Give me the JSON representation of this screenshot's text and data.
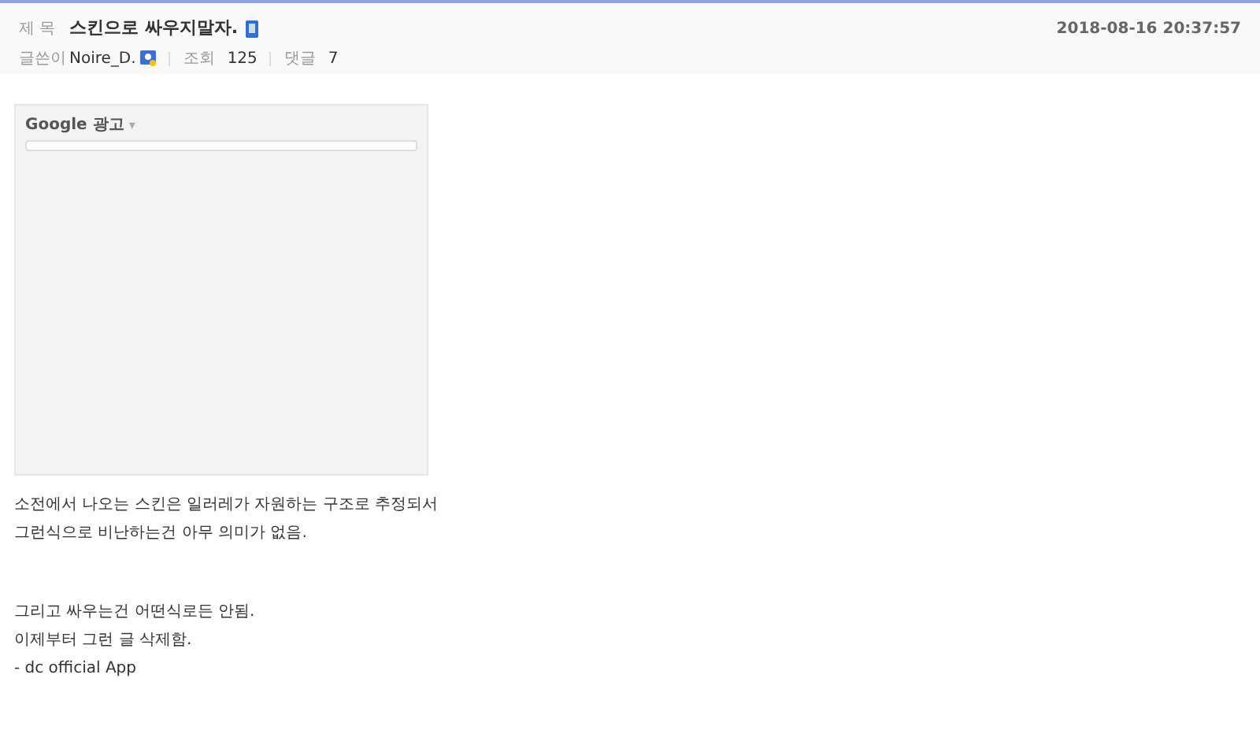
{
  "header": {
    "title_label": "제 목",
    "title": "스킨으로 싸우지말자.",
    "date": "2018-08-16 20:37:57",
    "author_label": "글쓴이",
    "author": "Noire_D.",
    "views_label": "조회",
    "views": "125",
    "comments_label": "댓글",
    "comments": "7"
  },
  "ad": {
    "label": "Google 광고",
    "caret": "▾"
  },
  "paragraphs": [
    [
      "소전에서 나오는 스킨은 일러레가 자원하는 구조로 추정되서",
      "그런식으로 비난하는건 아무 의미가 없음."
    ],
    [
      "그리고 싸우는건 어떤식로든 안됨.",
      "이제부터 그런 글 삭제함.",
      "- dc official App"
    ]
  ]
}
